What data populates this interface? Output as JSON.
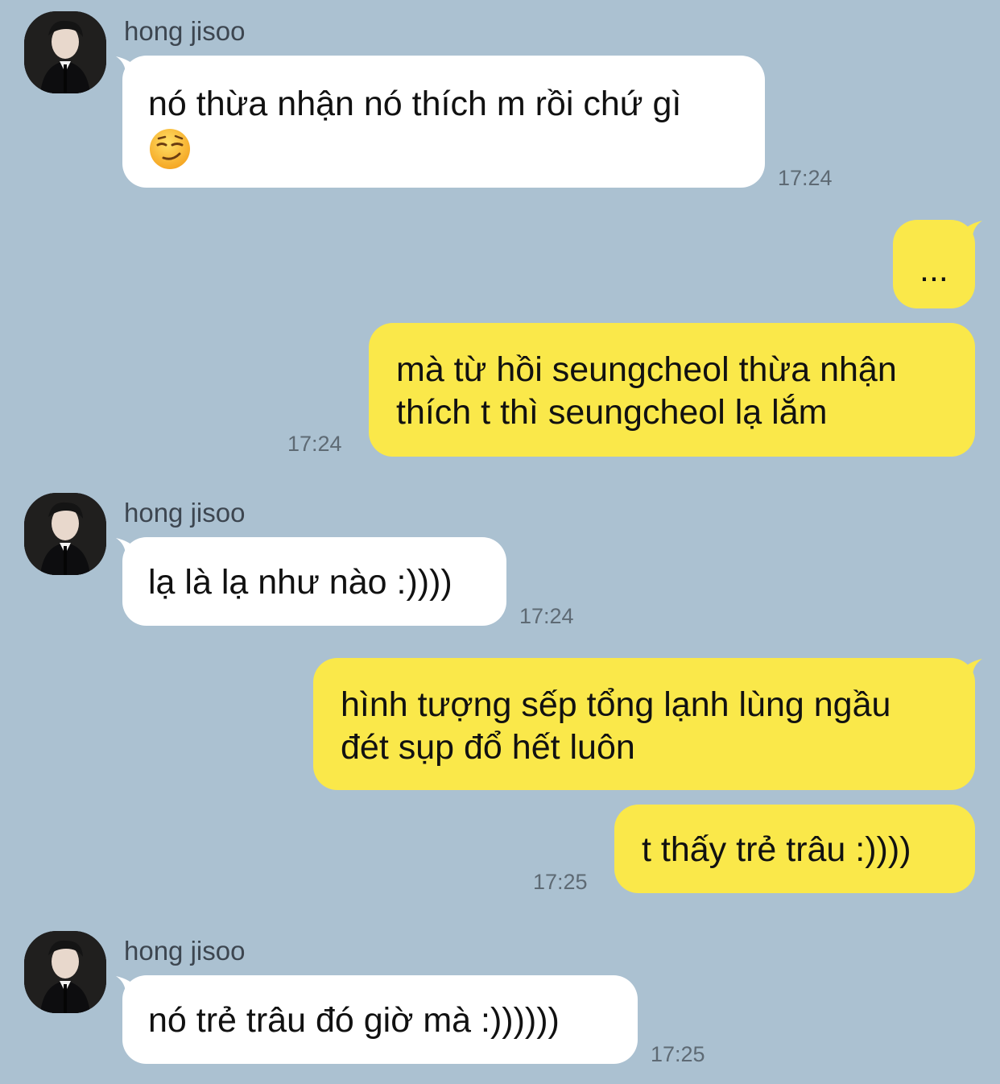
{
  "messages": [
    {
      "sender": "hong jisoo",
      "text": "nó thừa nhận nó thích m rồi chứ gì",
      "emoji": "smirking-face",
      "time": "17:24"
    },
    {
      "text": "...",
      "direction": "out"
    },
    {
      "text": "mà từ hồi seungcheol thừa nhận\nthích t thì seungcheol lạ lắm",
      "time": "17:24",
      "direction": "out"
    },
    {
      "sender": "hong jisoo",
      "text": "lạ là lạ như nào :))))",
      "time": "17:24"
    },
    {
      "text": "hình tượng sếp tổng lạnh lùng ngầu\nđét sụp đổ hết luôn",
      "direction": "out"
    },
    {
      "text": "t thấy trẻ trâu :))))",
      "time": "17:25",
      "direction": "out"
    },
    {
      "sender": "hong jisoo",
      "text": "nó trẻ trâu đó giờ mà :))))))",
      "time": "17:25"
    }
  ],
  "colors": {
    "background": "#abc1d1",
    "incoming_bubble": "#ffffff",
    "outgoing_bubble": "#fae84a"
  }
}
